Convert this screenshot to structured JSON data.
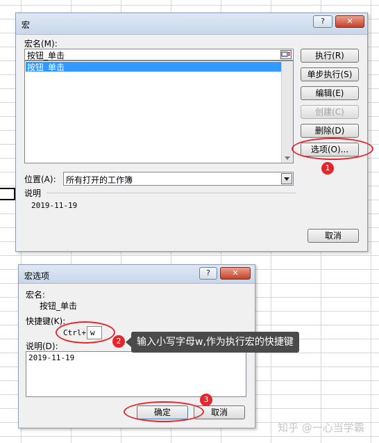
{
  "macro_dialog": {
    "title": "宏",
    "help_glyph": "?",
    "close_glyph": "✕",
    "macro_name_label": "宏名(M):",
    "macro_name_value": "按钮_单击",
    "macro_list": [
      "按钮_单击"
    ],
    "buttons": {
      "run": "执行(R)",
      "step_into": "单步执行(S)",
      "edit": "编辑(E)",
      "create": "创建(C)",
      "delete": "删除(D)",
      "options": "选项(O)...",
      "cancel": "取消"
    },
    "location_label": "位置(A):",
    "location_value": "所有打开的工作簿",
    "description_label": "说明",
    "description_value": "2019-11-19"
  },
  "options_dialog": {
    "title": "宏选项",
    "help_glyph": "?",
    "close_glyph": "✕",
    "macro_name_label": "宏名:",
    "macro_name_value": "按钮_单击",
    "shortcut_label": "快捷键(K):",
    "ctrl_prefix": "Ctrl+",
    "shortcut_value": "w",
    "description_label": "说明(D):",
    "description_value": "2019-11-19",
    "ok": "确定",
    "cancel": "取消"
  },
  "annotations": {
    "badge_1": "1",
    "badge_2": "2",
    "badge_3": "3",
    "tip_text": "输入小写字母w,作为执行宏的快捷键",
    "accent_color": "#e4262c"
  },
  "watermark": "知乎 @一心当学霸"
}
